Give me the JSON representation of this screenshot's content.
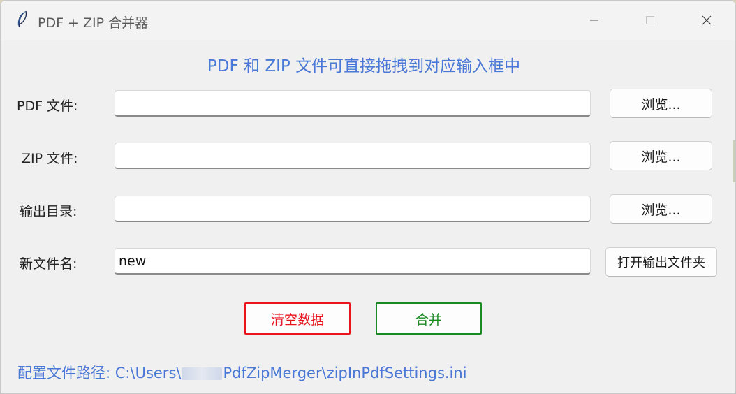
{
  "window": {
    "title": "PDF + ZIP 合并器",
    "app_icon": "feather-icon",
    "controls": [
      "minimize-icon",
      "maximize-icon",
      "close-icon"
    ]
  },
  "heading": "PDF 和 ZIP 文件可直接拖拽到对应输入框中",
  "fields": {
    "pdf": {
      "label": "PDF 文件:",
      "value": "",
      "browse_label": "浏览..."
    },
    "zip": {
      "label": "ZIP 文件:",
      "value": "",
      "browse_label": "浏览..."
    },
    "output_dir": {
      "label": "输出目录:",
      "value": "",
      "browse_label": "浏览..."
    },
    "new_name": {
      "label": "新文件名:",
      "value": "new",
      "open_folder_label": "打开输出文件夹"
    }
  },
  "actions": {
    "clear_label": "清空数据",
    "merge_label": "合并"
  },
  "config": {
    "prefix": "配置文件路径:",
    "path_start": "C:\\Users\\",
    "path_end": "PdfZipMerger\\zipInPdfSettings.ini"
  },
  "colors": {
    "accent_blue": "#4a78d6",
    "clear_red": "#e8141c",
    "merge_green": "#1a8a22"
  }
}
